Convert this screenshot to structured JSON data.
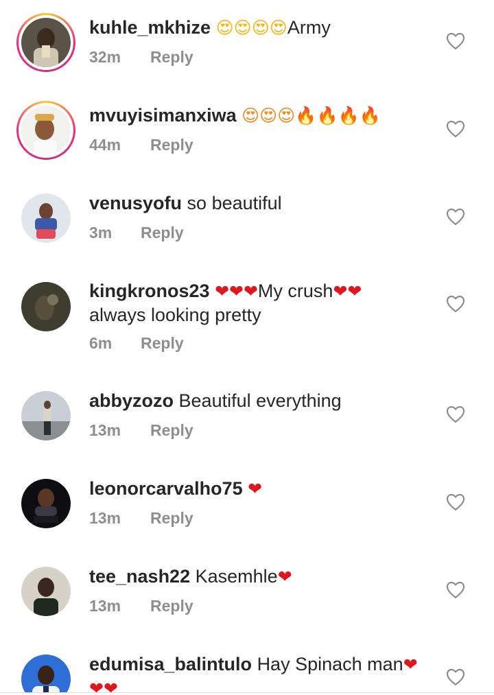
{
  "comments": [
    {
      "username": "kuhle_mkhize",
      "text": "Army",
      "emoji_before": "😍😍😍😍",
      "time": "32m",
      "reply": "Reply"
    },
    {
      "username": "mvuyisimanxiwa",
      "text": "",
      "emoji_before": "😍😍😍🔥🔥🔥🔥",
      "time": "44m",
      "reply": "Reply"
    },
    {
      "username": "venusyofu",
      "text": "so beautiful",
      "time": "3m",
      "reply": "Reply"
    },
    {
      "username": "kingkronos23",
      "emoji_a": "❤❤❤",
      "text_a": "My crush",
      "emoji_b": "❤❤",
      "text_line2": "always looking pretty",
      "time": "6m",
      "reply": "Reply"
    },
    {
      "username": "abbyzozo",
      "text": "Beautiful everything",
      "time": "13m",
      "reply": "Reply"
    },
    {
      "username": "leonorcarvalho75",
      "emoji_after": "❤",
      "time": "13m",
      "reply": "Reply"
    },
    {
      "username": "tee_nash22",
      "text": "Kasemhle",
      "emoji_after": "❤",
      "time": "13m",
      "reply": "Reply"
    },
    {
      "username": "edumisa_balintulo",
      "text": "Hay Spinach man",
      "emoji_after": "❤",
      "emoji_line2": "❤❤"
    }
  ],
  "icons": {
    "like": "heart-outline-icon"
  },
  "colors": {
    "username": "#262626",
    "meta": "#8e8e8e",
    "heart": "#e0161e",
    "like_outline": "#8e8e8e"
  }
}
